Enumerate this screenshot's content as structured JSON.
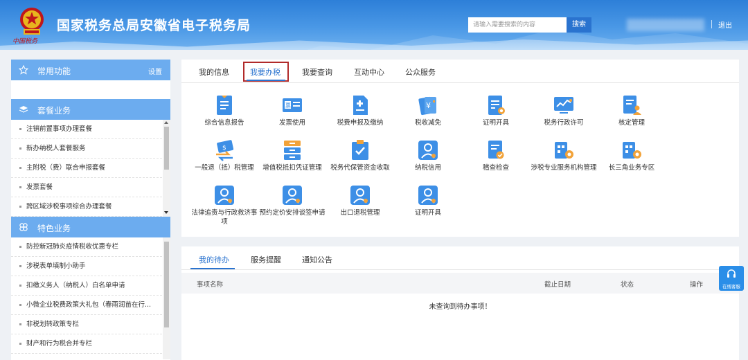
{
  "header": {
    "title": "国家税务总局安徽省电子税务局",
    "emblem_caption": "中国税务",
    "search_placeholder": "请输入需要搜索的内容",
    "search_label": "搜索",
    "logout_label": "退出"
  },
  "sidebar": {
    "common": {
      "title": "常用功能",
      "settings_label": "设置"
    },
    "package": {
      "title": "套餐业务",
      "items": [
        "注销前置事项办理套餐",
        "新办纳税人套餐服务",
        "主附税（费）联合申报套餐",
        "发票套餐",
        "跨区域涉税事项综合办理套餐"
      ]
    },
    "special": {
      "title": "特色业务",
      "items": [
        "防控新冠肺炎疫情税收优惠专栏",
        "涉税表单填制小助手",
        "扣缴义务人（纳税人）白名单申请",
        "小微企业税费政策大礼包（春雨润苗在行...",
        "非税划转政策专栏",
        "财产和行为税合并专栏"
      ]
    }
  },
  "main": {
    "tabs": [
      "我的信息",
      "我要办税",
      "我要查询",
      "互动中心",
      "公众服务"
    ],
    "active_tab": "我要办税",
    "services": [
      [
        "综合信息报告",
        "发票使用",
        "税费申报及缴纳",
        "税收减免",
        "证明开具",
        "税务行政许可",
        "核定管理"
      ],
      [
        "一般退（抵）税管理",
        "增值税抵扣凭证管理",
        "税务代保管资金收取",
        "纳税信用",
        "稽查检查",
        "涉税专业服务机构管理",
        "长三角业务专区"
      ],
      [
        "法律追责与行政救济事项",
        "预约定价安排谈签申请",
        "出口退税管理",
        "证明开具"
      ]
    ]
  },
  "todo": {
    "tabs": [
      "我的待办",
      "服务提醒",
      "通知公告"
    ],
    "columns": [
      "事项名称",
      "截止日期",
      "状态",
      "操作"
    ],
    "empty_text": "未查询到待办事项！"
  },
  "customer_service": {
    "label": "在线客服"
  },
  "colors": {
    "primary": "#2a73cf",
    "sidebar_header": "#6cacef",
    "active_frame": "#b12a2a"
  }
}
